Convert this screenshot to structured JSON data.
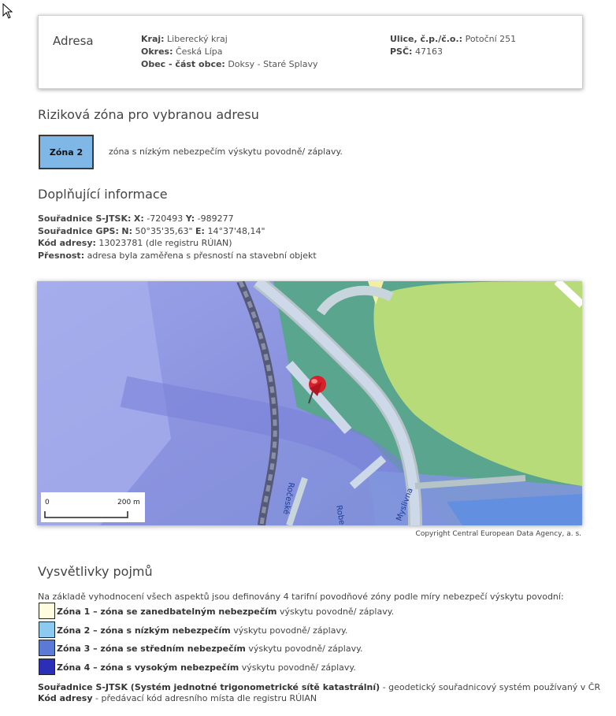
{
  "address": {
    "title": "Adresa",
    "kraj_label": "Kraj:",
    "kraj_value": "Liberecký kraj",
    "okres_label": "Okres:",
    "okres_value": "Česká Lípa",
    "obec_label": "Obec - část obce:",
    "obec_value": "Doksy - Staré Splavy",
    "ulice_label": "Ulice, č.p./č.o.:",
    "ulice_value": "Potoční 251",
    "psc_label": "PSČ:",
    "psc_value": "47163"
  },
  "risk": {
    "heading": "Riziková zóna pro vybranou adresu",
    "zone_label": "Zóna 2",
    "zone_color": "#7fb8e6",
    "zone_desc": "zóna s nízkým nebezpečím výskytu povodně/ záplavy."
  },
  "info": {
    "heading": "Doplňující informace",
    "sjtsk_label": "Souřadnice S-JTSK:",
    "x_label": "X:",
    "x_value": "-720493",
    "y_label": "Y:",
    "y_value": "-989277",
    "gps_label": "Souřadnice GPS:",
    "n_label": "N:",
    "n_value": "50°35'35,63\"",
    "e_label": "E:",
    "e_value": "14°37'48,14\"",
    "kod_label": "Kód adresy:",
    "kod_value": "13023781 (dle registru RÚIAN)",
    "presnost_label": "Přesnost:",
    "presnost_value": "adresa byla zaměřena s přesností na stavební objekt"
  },
  "map": {
    "scale_start": "0",
    "scale_end": "200 m",
    "street_1": "Robečská",
    "street_2": "Ročeské",
    "street_3": "Myslivna",
    "copyright": "Copyright Central European Data Agency, a. s."
  },
  "legend": {
    "heading": "Vysvětlivky pojmů",
    "intro": "Na základě vyhodnocení všech aspektů jsou definovány 4 tarifní povodňové zóny podle míry nebezpečí výskytu povodní:",
    "items": [
      {
        "label": "Zóna 1 – zóna se zanedbatelným nebezpečím",
        "suffix": "výskytu povodně/ záplavy.",
        "color": "#fffde0"
      },
      {
        "label": "Zóna 2 – zóna s nízkým nebezpečím",
        "suffix": "výskytu povodně/ záplavy.",
        "color": "#8ccaf0"
      },
      {
        "label": "Zóna 3 – zóna se středním nebezpečím",
        "suffix": "výskytu povodně/ záplavy.",
        "color": "#5b7ad6"
      },
      {
        "label": "Zóna 4 – zóna s vysokým nebezpečím",
        "suffix": "výskytu povodně/ záplavy.",
        "color": "#2b2fb8"
      }
    ],
    "term1_label": "Souřadnice S-JTSK (Systém jednotné trigonometrické sítě katastrální)",
    "term1_text": "- geodetický souřadnicový systém používaný v ČR",
    "term2_label": "Kód adresy",
    "term2_text": "- předávací kód adresního místa dle registru RÚIAN"
  }
}
